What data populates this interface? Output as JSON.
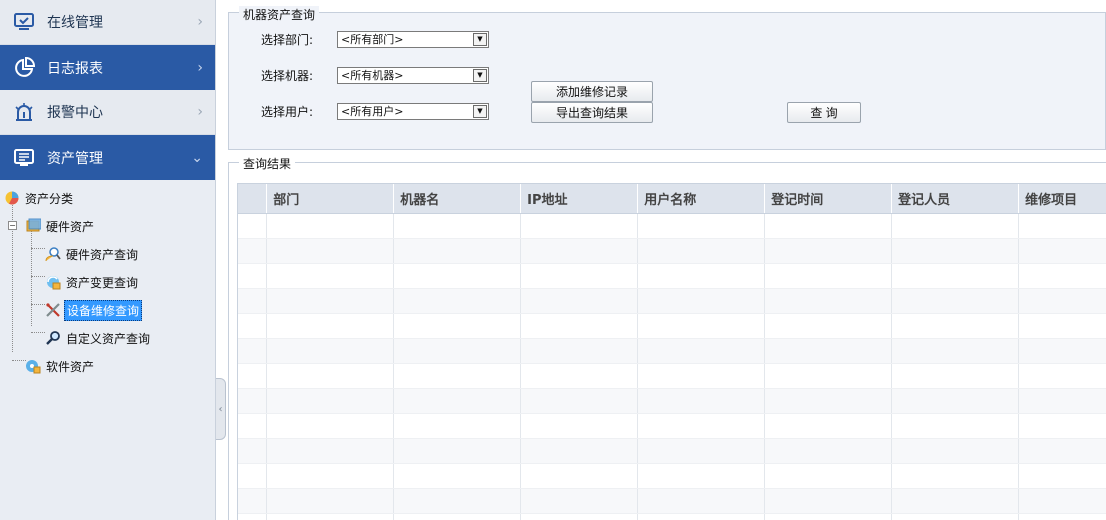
{
  "sidebar": {
    "nav": [
      {
        "label": "在线管理",
        "icon": "monitor-check-icon"
      },
      {
        "label": "日志报表",
        "icon": "pie-chart-icon"
      },
      {
        "label": "报警中心",
        "icon": "alarm-siren-icon"
      },
      {
        "label": "资产管理",
        "icon": "screen-list-icon"
      }
    ],
    "tree": {
      "root": "资产分类",
      "hardware": "硬件资产",
      "hardware_children": [
        "硬件资产查询",
        "资产变更查询",
        "设备维修查询",
        "自定义资产查询"
      ],
      "software": "软件资产",
      "selected": "设备维修查询"
    }
  },
  "collapse_glyph": "‹",
  "query": {
    "legend": "机器资产查询",
    "department_label": "选择部门:",
    "department_value": "<所有部门>",
    "machine_label": "选择机器:",
    "machine_value": "<所有机器>",
    "user_label": "选择用户:",
    "user_value": "<所有用户>",
    "add_repair_button": "添加维修记录",
    "export_button": "导出查询结果",
    "query_button": "查 询"
  },
  "results": {
    "legend": "查询结果",
    "columns": [
      "部门",
      "机器名",
      "IP地址",
      "用户名称",
      "登记时间",
      "登记人员",
      "维修项目"
    ]
  },
  "colors": {
    "nav_active": "#2a5aa5",
    "nav_inactive": "#e6eaf0",
    "selection": "#3399ff"
  }
}
